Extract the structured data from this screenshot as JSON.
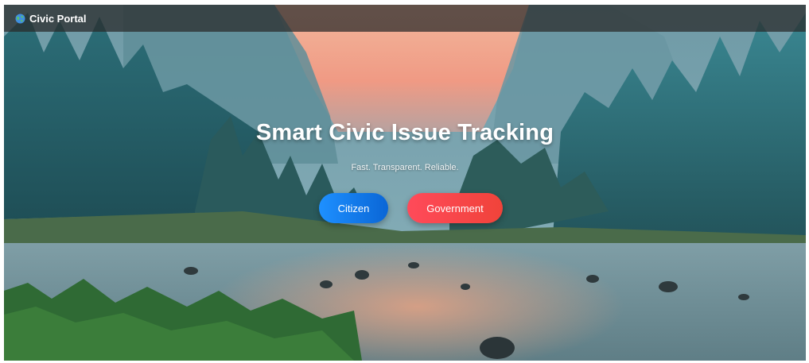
{
  "navbar": {
    "brand_label": "Civic Portal",
    "brand_icon": "globe-icon"
  },
  "hero": {
    "title": "Smart Civic Issue Tracking",
    "tagline": "Fast. Transparent. Reliable.",
    "buttons": {
      "citizen_label": "Citizen",
      "government_label": "Government"
    }
  },
  "colors": {
    "navbar_bg": "#282828",
    "citizen_button": "#1e90ff",
    "government_button": "#ff4a5a",
    "text": "#ffffff"
  }
}
